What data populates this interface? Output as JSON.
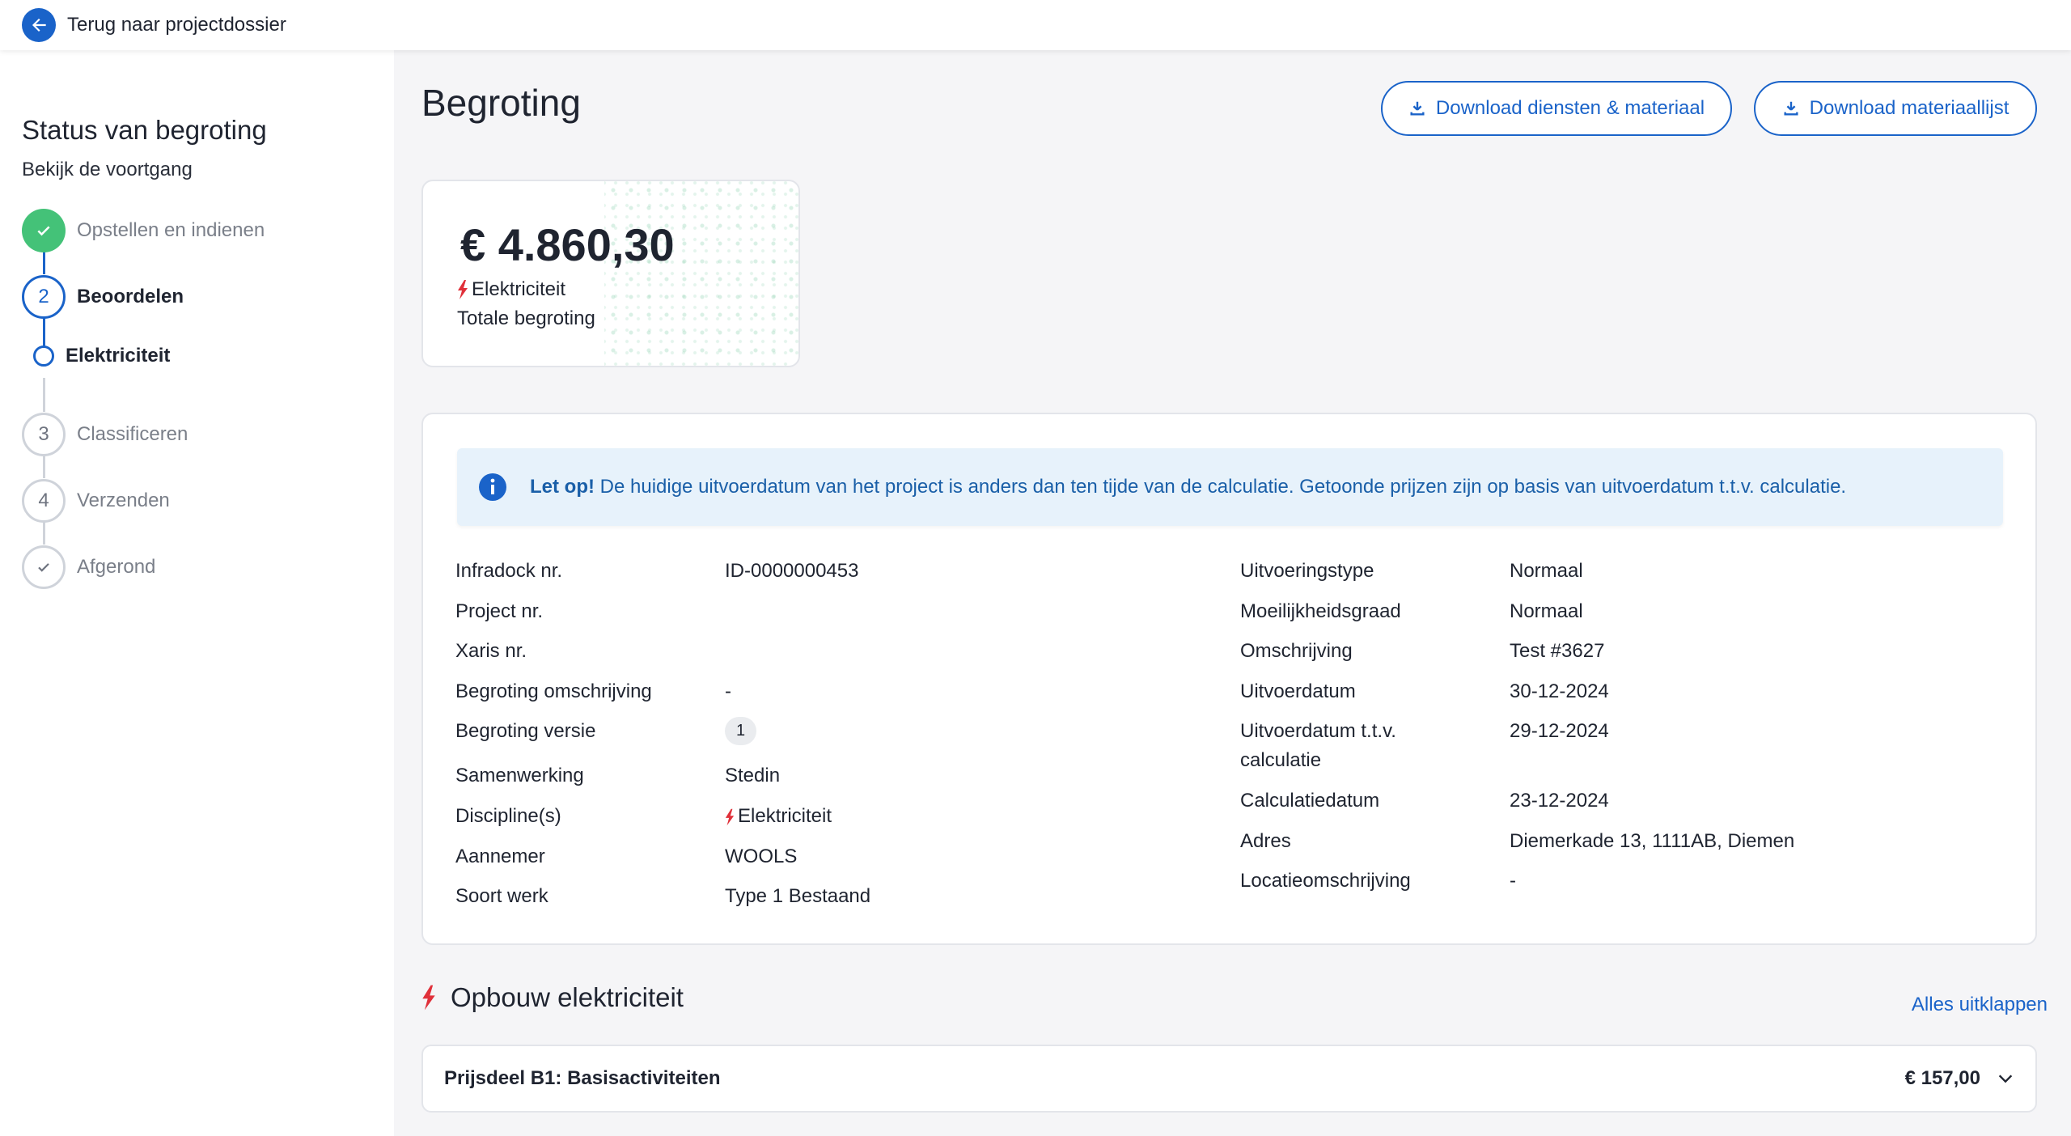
{
  "topbar": {
    "back_label": "Terug naar projectdossier"
  },
  "sidebar": {
    "title": "Status van begroting",
    "subtitle": "Bekijk de voortgang",
    "steps": [
      {
        "marker": "",
        "label": "Opstellen en indienen",
        "state": "done"
      },
      {
        "marker": "2",
        "label": "Beoordelen",
        "state": "active"
      },
      {
        "marker": "",
        "label": "Elektriciteit",
        "state": "sub-active"
      },
      {
        "marker": "3",
        "label": "Classificeren",
        "state": "todo"
      },
      {
        "marker": "4",
        "label": "Verzenden",
        "state": "todo"
      },
      {
        "marker": "",
        "label": "Afgerond",
        "state": "todo-check"
      }
    ]
  },
  "main": {
    "title": "Begroting",
    "download_services": "Download diensten & materiaal",
    "download_materials": "Download materiaallijst",
    "total": {
      "amount": "€ 4.860,30",
      "discipline": "Elektriciteit",
      "label": "Totale begroting"
    },
    "notice": {
      "strong": "Let op!",
      "text": " De huidige uitvoerdatum van het project is anders dan ten tijde van de calculatie. Getoonde prijzen zijn op basis van uitvoerdatum t.t.v. calculatie."
    },
    "left_fields": [
      {
        "key": "Infradock nr.",
        "value": "ID-0000000453"
      },
      {
        "key": "Project nr.",
        "value": ""
      },
      {
        "key": "Xaris nr.",
        "value": ""
      },
      {
        "key": "Begroting omschrijving",
        "value": "-"
      },
      {
        "key": "Begroting versie",
        "value": "1"
      },
      {
        "key": "Samenwerking",
        "value": "Stedin"
      },
      {
        "key": "Discipline(s)",
        "value": "Elektriciteit"
      },
      {
        "key": "Aannemer",
        "value": "WOOLS"
      },
      {
        "key": "Soort werk",
        "value": "Type 1 Bestaand"
      }
    ],
    "right_fields": [
      {
        "key": "Uitvoeringstype",
        "value": "Normaal"
      },
      {
        "key": "Moeilijkheidsgraad",
        "value": "Normaal"
      },
      {
        "key": "Omschrijving",
        "value": "Test #3627"
      },
      {
        "key": "Uitvoerdatum",
        "value": "30-12-2024"
      },
      {
        "key": "Uitvoerdatum t.t.v.",
        "key2": "calculatie",
        "value": "29-12-2024"
      },
      {
        "key": "Calculatiedatum",
        "value": "23-12-2024"
      },
      {
        "key": "Adres",
        "value": "Diemerkade 13, 1111AB, Diemen"
      },
      {
        "key": "Locatieomschrijving",
        "value": "-"
      }
    ],
    "section_title": "Opbouw elektriciteit",
    "expand_all": "Alles uitklappen",
    "accordion": [
      {
        "label": "Prijsdeel B1: Basisactiviteiten",
        "amount": "€ 157,00"
      }
    ]
  },
  "colors": {
    "primary": "#1a63c9",
    "success": "#44c278",
    "bolt": "#e0303a",
    "notice_bg": "#e7f2fb"
  }
}
